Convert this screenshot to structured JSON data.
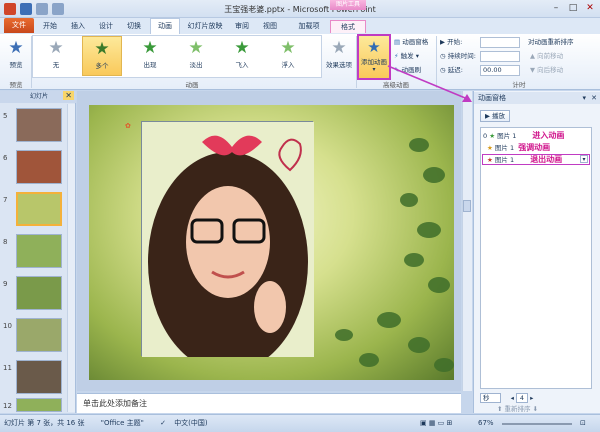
{
  "window": {
    "title": "王宝强老婆.pptx - Microsoft PowerPoint",
    "tools_label": "图片工具"
  },
  "tabs": [
    "文件",
    "开始",
    "插入",
    "设计",
    "切换",
    "动画",
    "幻灯片放映",
    "审阅",
    "视图",
    "加载项",
    "格式"
  ],
  "ribbon": {
    "preview_label": "预览",
    "preview_group": "预览",
    "effects": [
      "无",
      "多个",
      "出现",
      "淡出",
      "飞入",
      "浮入"
    ],
    "effect_options": "效果选项",
    "animation_group": "动画",
    "add_animation": "添加动画",
    "anim_pane_btn": "动画窗格",
    "trigger_btn": "触发",
    "anim_painter_btn": "动画刷",
    "advanced_group": "高级动画",
    "start_label": "开始:",
    "duration_label": "持续时间:",
    "delay_label": "延迟:",
    "delay_value": "00.00",
    "timing_group": "计时",
    "reorder_label": "对动画重新排序",
    "move_earlier": "向前移动",
    "move_later": "向后移动"
  },
  "slides": {
    "tab_label": "幻灯片",
    "numbers": [
      "5",
      "6",
      "7",
      "8",
      "9",
      "10",
      "11",
      "12"
    ]
  },
  "notes_placeholder": "单击此处添加备注",
  "anim_pane": {
    "title": "动画窗格",
    "play_label": "播放",
    "items": [
      {
        "num": "0",
        "name": "图片 1",
        "annotation": "进入动画"
      },
      {
        "num": "",
        "name": "图片 1",
        "annotation": "强调动画"
      },
      {
        "num": "",
        "name": "图片 1",
        "annotation": "退出动画"
      }
    ],
    "seconds_label": "秒",
    "page_value": "4",
    "reorder_label": "重新排序"
  },
  "status": {
    "slide_info": "幻灯片 第 7 张，共 16 张",
    "theme": "\"Office 主题\"",
    "language": "中文(中国)",
    "zoom": "67%"
  },
  "colors": {
    "accent": "#c03bc3",
    "file_tab": "#d85420",
    "annotation": "#d0158c"
  }
}
